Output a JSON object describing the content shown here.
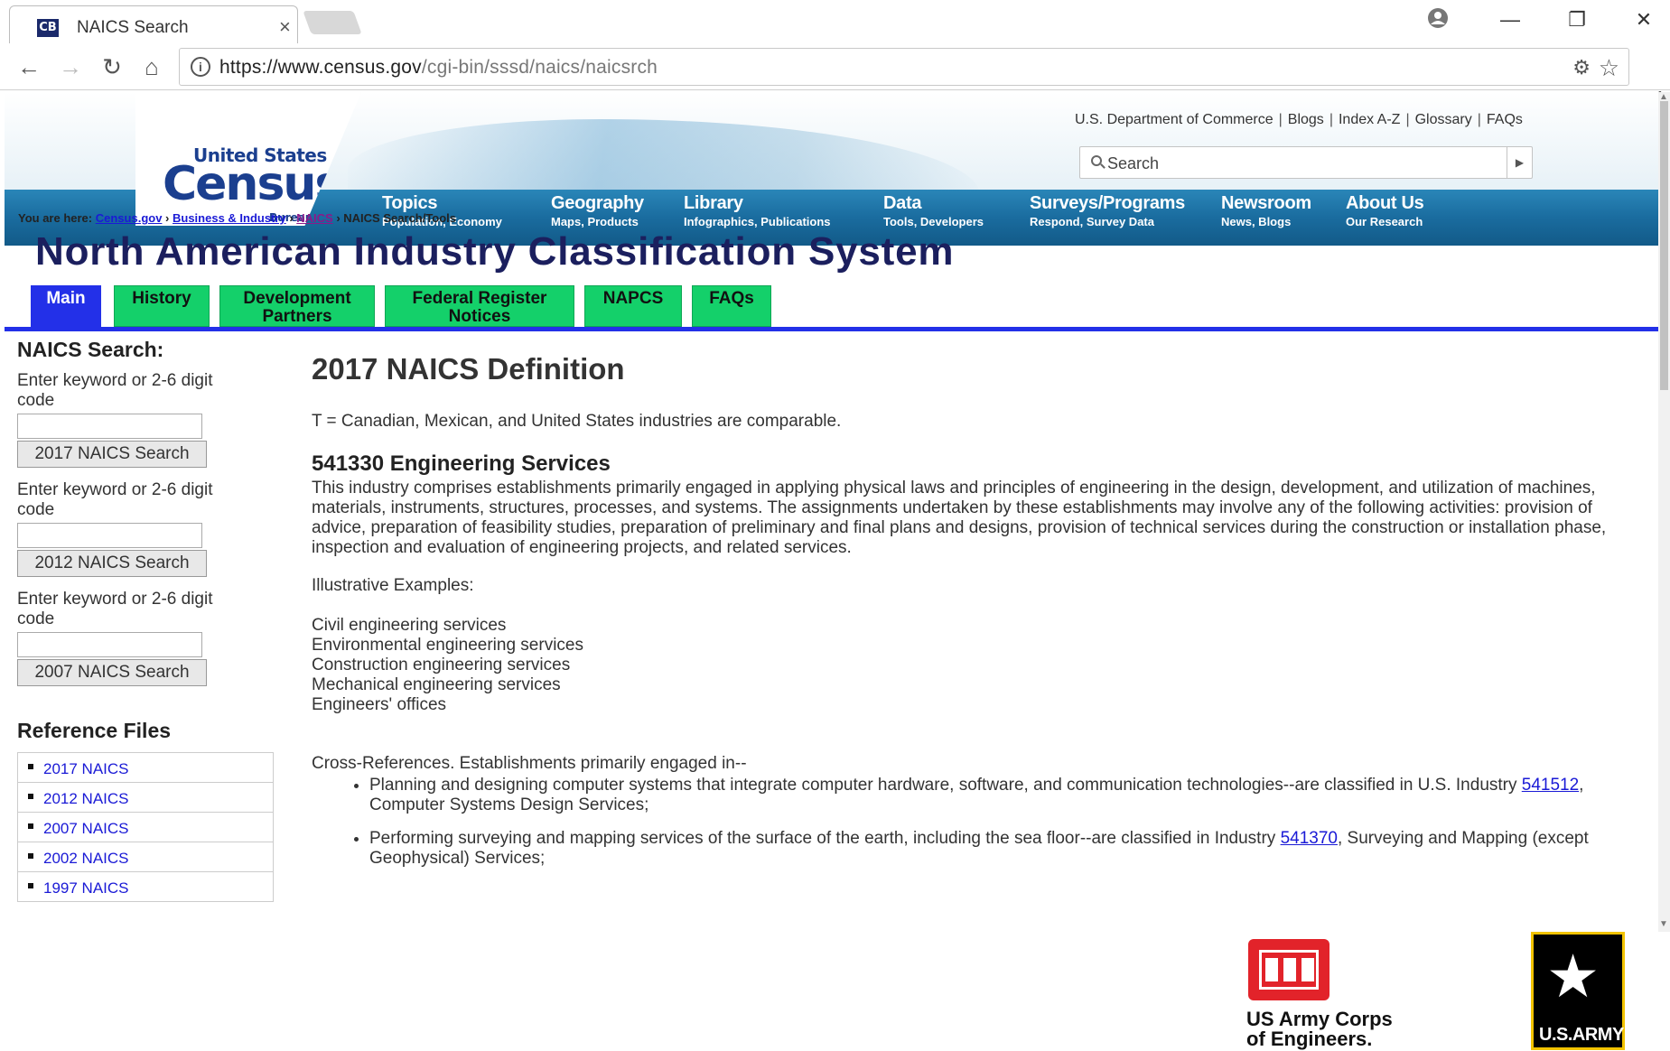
{
  "browser": {
    "tab_title": "NAICS Search",
    "tab_favicon": "CB",
    "tab_close": "×",
    "url_host": "https://www.census.gov",
    "url_path": "/cgi-bin/sssd/naics/naicsrch"
  },
  "header": {
    "logo_line1": "United States",
    "logo_line2": "Census",
    "logo_line3": "Bureau",
    "util_links": [
      "U.S. Department of Commerce",
      "Blogs",
      "Index A-Z",
      "Glossary",
      "FAQs"
    ],
    "search_placeholder": "Search",
    "nav": [
      {
        "title": "Topics",
        "sub": "Population, Economy"
      },
      {
        "title": "Geography",
        "sub": "Maps, Products"
      },
      {
        "title": "Library",
        "sub": "Infographics, Publications"
      },
      {
        "title": "Data",
        "sub": "Tools, Developers"
      },
      {
        "title": "Surveys/Programs",
        "sub": "Respond, Survey Data"
      },
      {
        "title": "Newsroom",
        "sub": "News, Blogs"
      },
      {
        "title": "About Us",
        "sub": "Our Research"
      }
    ]
  },
  "breadcrumb": {
    "prefix": "You are here:",
    "links": [
      "Census.gov",
      "Business & Industry",
      "NAICS"
    ],
    "current": "NAICS Search/Tools"
  },
  "page_title": "North American Industry Classification System",
  "tabs": [
    {
      "label": "Main",
      "active": true
    },
    {
      "label": "History"
    },
    {
      "label": "Development Partners"
    },
    {
      "label": "Federal Register Notices"
    },
    {
      "label": "NAPCS"
    },
    {
      "label": "FAQs"
    }
  ],
  "sidebar": {
    "heading": "NAICS Search:",
    "searches": [
      {
        "prompt": "Enter keyword or 2-6 digit code",
        "button": "2017 NAICS Search"
      },
      {
        "prompt": "Enter keyword or 2-6 digit code",
        "button": "2012 NAICS Search"
      },
      {
        "prompt": "Enter keyword or 2-6 digit code",
        "button": "2007 NAICS Search"
      }
    ],
    "ref_heading": "Reference Files",
    "ref_files": [
      "2017 NAICS",
      "2012 NAICS",
      "2007 NAICS",
      "2002 NAICS",
      "1997 NAICS"
    ]
  },
  "main": {
    "title": "2017 NAICS Definition",
    "note": "T = Canadian, Mexican, and United States industries are comparable.",
    "code_title": "541330 Engineering Services",
    "description": "This industry comprises establishments primarily engaged in applying physical laws and principles of engineering in the design, development, and utilization of machines, materials, instruments, structures, processes, and systems. The assignments undertaken by these establishments may involve any of the following activities: provision of advice, preparation of feasibility studies, preparation of preliminary and final plans and designs, provision of technical services during the construction or installation phase, inspection and evaluation of engineering projects, and related services.",
    "illustrative_label": "Illustrative Examples:",
    "examples": [
      "Civil engineering services",
      "Environmental engineering services",
      "Construction engineering services",
      "Mechanical engineering services",
      "Engineers' offices"
    ],
    "xref_label": "Cross-References. Establishments primarily engaged in--",
    "xrefs": [
      {
        "before": "Planning and designing computer systems that integrate computer hardware, software, and communication technologies--are classified in U.S. Industry ",
        "code": "541512",
        "after": ", Computer Systems Design Services;"
      },
      {
        "before": "Performing surveying and mapping services of the surface of the earth, including the sea floor--are classified in Industry ",
        "code": "541370",
        "after": ", Surveying and Mapping (except Geophysical) Services;"
      }
    ]
  },
  "footer": {
    "usace_line1": "US Army Corps",
    "usace_line2": "of Engineers.",
    "army_text": "U.S.ARMY"
  },
  "colors": {
    "nav_blue": "#1a6c9f",
    "tab_green": "#14d06a",
    "tab_active": "#2330e8",
    "title_navy": "#1b1f5e",
    "link_blue": "#1a1ad6"
  }
}
